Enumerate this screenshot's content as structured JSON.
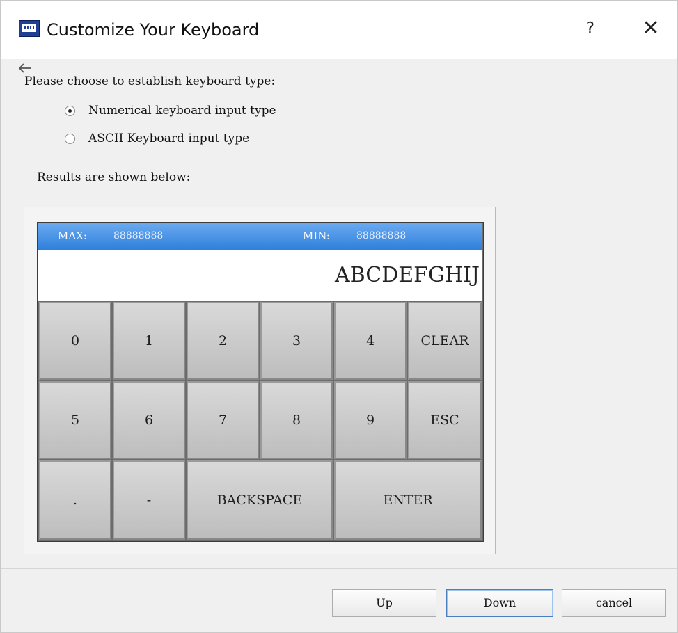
{
  "window": {
    "title": "Customize Your Keyboard",
    "help_label": "?",
    "close_label": "✕",
    "app_icon": "hmi-icon"
  },
  "prompt": "Please choose to establish keyboard type:",
  "options": [
    {
      "label": "Numerical keyboard input type",
      "selected": true
    },
    {
      "label": "ASCII Keyboard input type",
      "selected": false
    }
  ],
  "results_label": "Results are shown below:",
  "keypad": {
    "max_label": "MAX:",
    "max_value": "88888888",
    "min_label": "MIN:",
    "min_value": "88888888",
    "display": "ABCDEFGHIJ",
    "row1": [
      "0",
      "1",
      "2",
      "3",
      "4",
      "CLEAR"
    ],
    "row2": [
      "5",
      "6",
      "7",
      "8",
      "9",
      "ESC"
    ],
    "row3": [
      ".",
      "-",
      "BACKSPACE",
      "ENTER"
    ],
    "header_color": "#3a87e0"
  },
  "buttons": {
    "up": "Up",
    "down": "Down",
    "cancel": "cancel"
  }
}
